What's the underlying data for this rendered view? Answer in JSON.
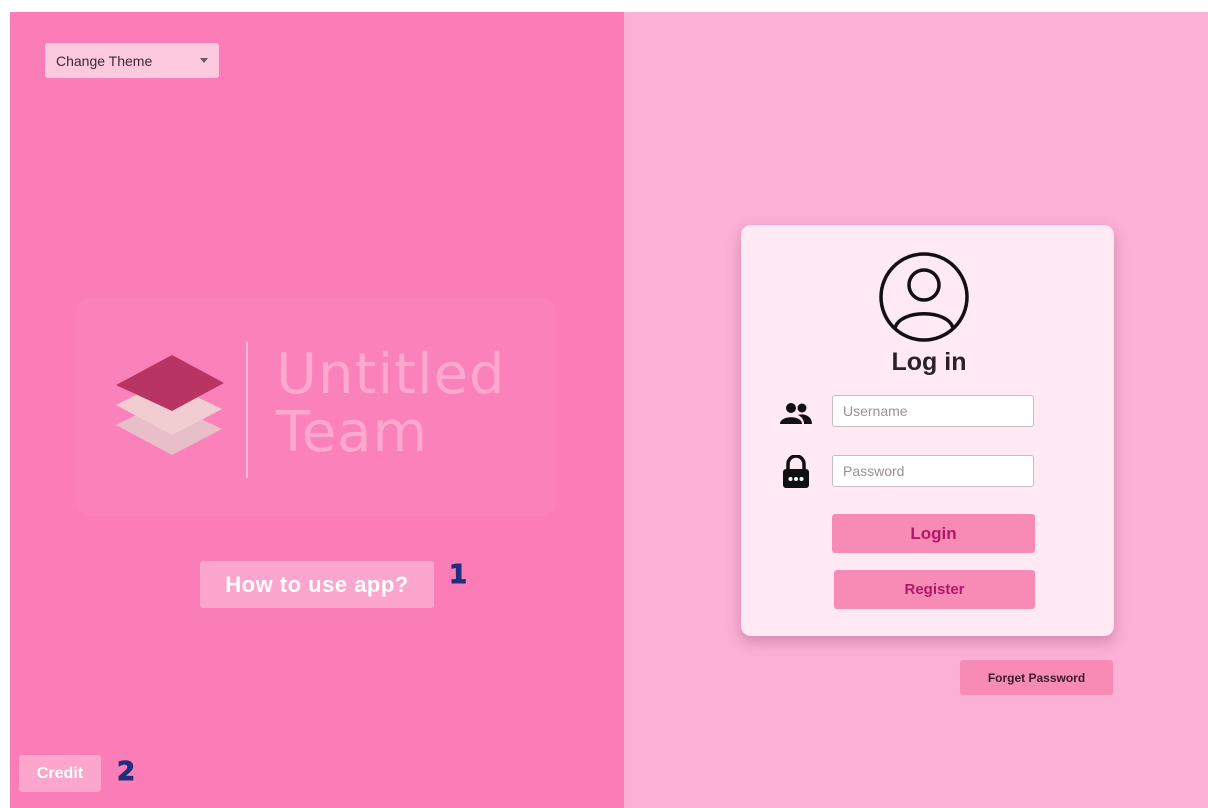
{
  "theme_selector": {
    "label": "Change Theme",
    "icon": "chevron-down-icon"
  },
  "logo": {
    "line1": "Untitled",
    "line2": "Team",
    "icon": "layers-icon"
  },
  "left": {
    "how_to_use_label": "How to use app?",
    "credit_label": "Credit",
    "annotation_1": "1",
    "annotation_2": "2"
  },
  "login": {
    "title": "Log in",
    "avatar_icon": "user-circle-icon",
    "username_icon": "people-icon",
    "password_icon": "lock-icon",
    "username_placeholder": "Username",
    "password_placeholder": "Password",
    "login_label": "Login",
    "register_label": "Register",
    "forget_label": "Forget Password"
  },
  "colors": {
    "left_panel": "#fb7db8",
    "right_panel": "#fbb0d5",
    "card": "#ffeaf4",
    "button": "#f78bb5",
    "button_text": "#b2166a",
    "annotation": "#1f2f7a"
  }
}
